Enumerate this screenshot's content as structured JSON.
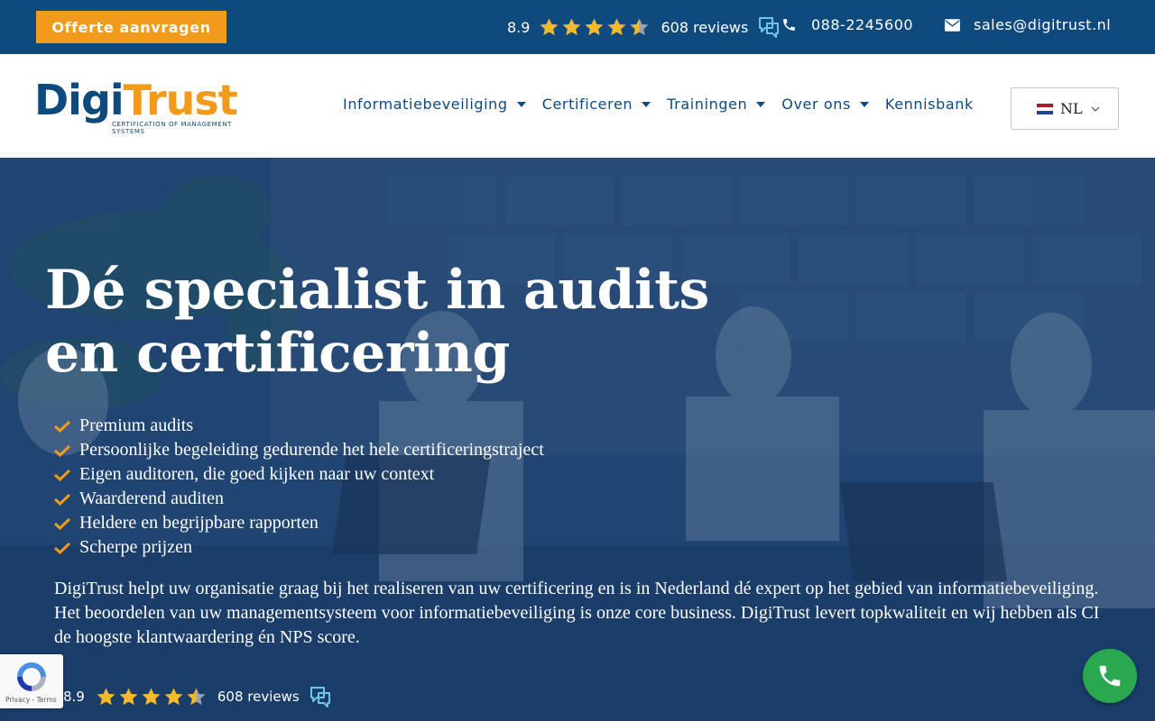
{
  "topbar": {
    "quote_button": "Offerte aanvragen",
    "rating_score": "8.9",
    "rating_stars": 4.5,
    "reviews": "608 reviews",
    "phone": "088-2245600",
    "email": "sales@digitrust.nl"
  },
  "header": {
    "logo": {
      "part1": "Digi",
      "part2": "Trust",
      "subtitle": "CERTIFICATION OF MANAGEMENT SYSTEMS"
    },
    "nav": [
      {
        "label": "Informatiebeveiliging",
        "has_dropdown": true
      },
      {
        "label": "Certificeren",
        "has_dropdown": true
      },
      {
        "label": "Trainingen",
        "has_dropdown": true
      },
      {
        "label": "Over ons",
        "has_dropdown": true
      },
      {
        "label": "Kennisbank",
        "has_dropdown": false
      }
    ],
    "language": "NL"
  },
  "hero": {
    "title": "Dé specialist in audits en certificering",
    "checklist": [
      "Premium audits",
      "Persoonlijke begeleiding gedurende het hele certificeringstraject",
      "Eigen auditoren, die goed kijken naar uw context",
      "Waarderend auditen",
      "Heldere en begrijpbare rapporten",
      "Scherpe prijzen"
    ],
    "description": "DigiTrust helpt uw organisatie graag bij het realiseren van uw certificering en is in Nederland dé expert op het gebied van informatiebeveiliging. Het beoordelen van uw managementsysteem voor informatiebeveiliging is onze core business. DigiTrust levert topkwaliteit en wij hebben als CI de hoogste klantwaardering én NPS score.",
    "rating_score": "8.9",
    "rating_stars": 4.5,
    "reviews": "608 reviews"
  },
  "recaptcha": {
    "terms": "Privacy - Terms"
  },
  "colors": {
    "brand_blue": "#0f4a7e",
    "brand_orange": "#f29a1b",
    "star": "#f5b82e",
    "call_green": "#2aa84f"
  },
  "icons": {
    "phone": "phone-icon",
    "mail": "envelope-icon",
    "review": "chat-bubble-icon",
    "check": "check-icon",
    "call": "phone-call-icon"
  }
}
